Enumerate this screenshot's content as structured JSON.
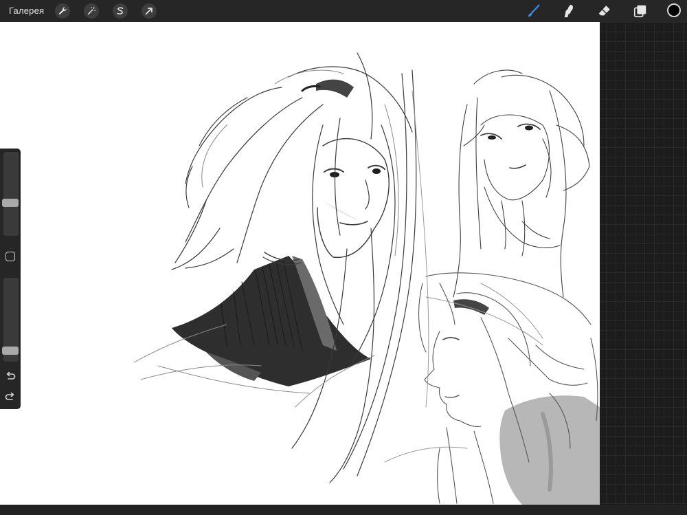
{
  "topbar": {
    "gallery_label": "Галерея",
    "left_tools": [
      {
        "name": "actions",
        "icon": "wrench-icon"
      },
      {
        "name": "adjustments",
        "icon": "magic-wand-icon"
      },
      {
        "name": "selection",
        "icon": "selection-s-icon"
      },
      {
        "name": "transform",
        "icon": "transform-arrow-icon"
      }
    ],
    "right_tools": [
      {
        "name": "brush",
        "icon": "brush-icon",
        "active": true
      },
      {
        "name": "smudge",
        "icon": "smudge-icon",
        "active": false
      },
      {
        "name": "eraser",
        "icon": "eraser-icon",
        "active": false
      },
      {
        "name": "layers",
        "icon": "layers-icon",
        "active": false
      }
    ],
    "current_color": "#000000",
    "active_tool_color": "#3b8fe8"
  },
  "sidebar": {
    "brush_size_level": 0.38,
    "opacity_level": 0.09,
    "modify_icon": "modify-square-icon",
    "undo_icon": "undo-icon",
    "redo_icon": "redo-icon"
  },
  "canvas": {
    "content": "sketch"
  }
}
